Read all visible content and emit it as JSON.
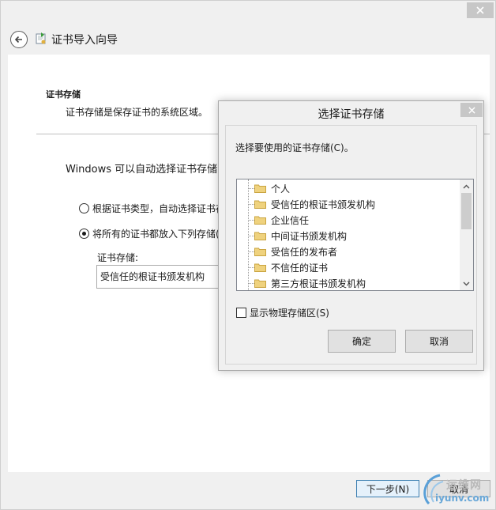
{
  "wizard": {
    "title": "证书导入向导",
    "section_title": "证书存储",
    "section_desc": "证书存储是保存证书的系统区域。",
    "auto_text": "Windows 可以自动选择证书存储，你",
    "radio_auto_label": "根据证书类型，自动选择证书存",
    "radio_manual_label": "将所有的证书都放入下列存储(",
    "radio_selected": "manual",
    "store_label": "证书存储:",
    "store_value": "受信任的根证书颁发机构",
    "next_label": "下一步(N)",
    "cancel_label": "取消"
  },
  "dialog": {
    "title": "选择证书存储",
    "prompt": "选择要使用的证书存储(C)。",
    "tree_items": [
      "个人",
      "受信任的根证书颁发机构",
      "企业信任",
      "中间证书颁发机构",
      "受信任的发布者",
      "不信任的证书",
      "第三方根证书颁发机构"
    ],
    "show_physical_label": "显示物理存储区(S)",
    "show_physical_checked": false,
    "ok_label": "确定",
    "cancel_label": "取消"
  },
  "watermark": {
    "cn": "运维网",
    "url": "iyunv.com"
  },
  "colors": {
    "window_bg": "#f0f0f0",
    "content_bg": "#ffffff",
    "close_btn": "#c7c7c7",
    "default_button_border": "#3c7fb1",
    "folder": "#e8c56a",
    "watermark_blue": "#6aa8d8"
  },
  "icons": {
    "back": "back-arrow-icon",
    "wizard": "certificate-import-icon",
    "close": "close-icon",
    "folder": "folder-icon",
    "scroll_up": "chevron-up-icon",
    "scroll_down": "chevron-down-icon"
  }
}
